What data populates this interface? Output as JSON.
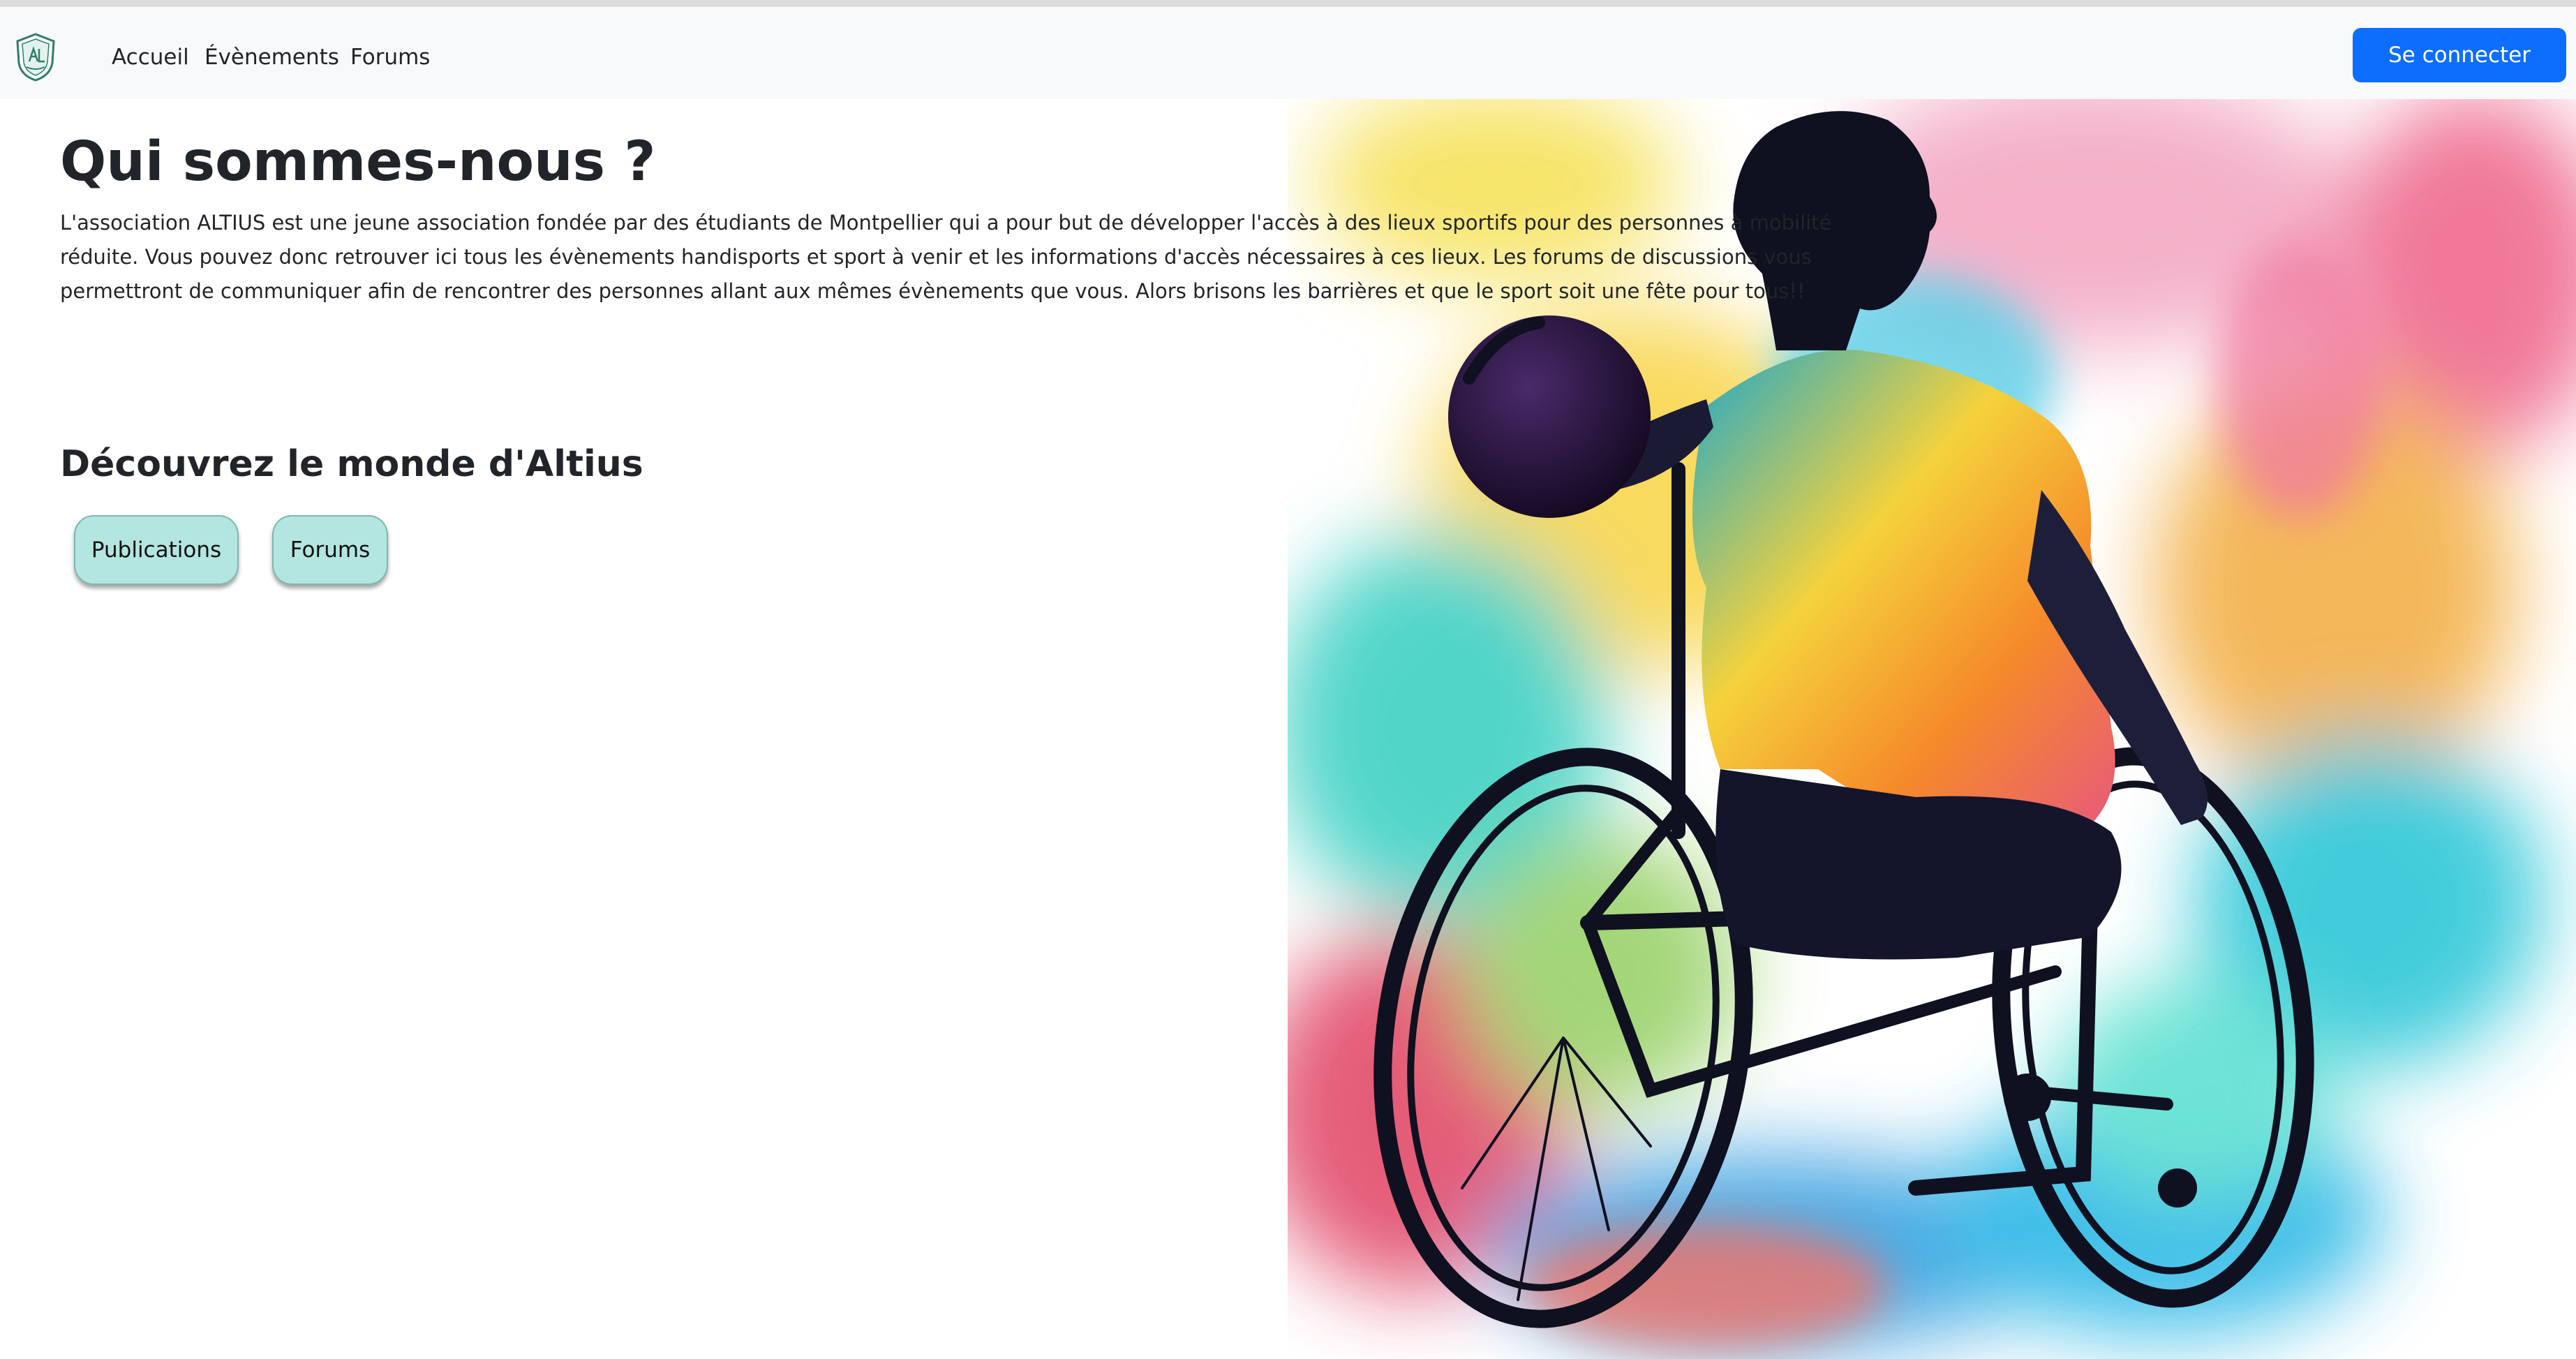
{
  "nav": {
    "logo_icon": "altius-shield-logo",
    "items": [
      {
        "label": "Accueil"
      },
      {
        "label": "Évènements"
      },
      {
        "label": "Forums"
      }
    ],
    "login_label": "Se connecter"
  },
  "main": {
    "title": "Qui sommes-nous ?",
    "intro": "L'association ALTIUS est une jeune association fondée par des étudiants de Montpellier qui a pour but de développer l'accès à des lieux sportifs pour des personnes à mobilité réduite. Vous pouvez donc retrouver ici tous les évènements handisports et sport à venir et les informations d'accès nécessaires à ces lieux. Les forums de discussions vous permettront de communiquer afin de rencontrer des personnes allant aux mêmes évènements que vous. Alors brisons les barrières et que le sport soit une fête pour tous!!",
    "discover_heading": "Découvrez le monde d'Altius",
    "buttons": [
      {
        "label": "Publications"
      },
      {
        "label": "Forums"
      }
    ]
  },
  "hero": {
    "image_subject": "wheelchair-basketball-player-watercolor"
  },
  "colors": {
    "navbar_bg": "#f8f9fa",
    "primary": "#0d6efd",
    "pill_bg": "#b3e6e0",
    "text": "#212529"
  }
}
